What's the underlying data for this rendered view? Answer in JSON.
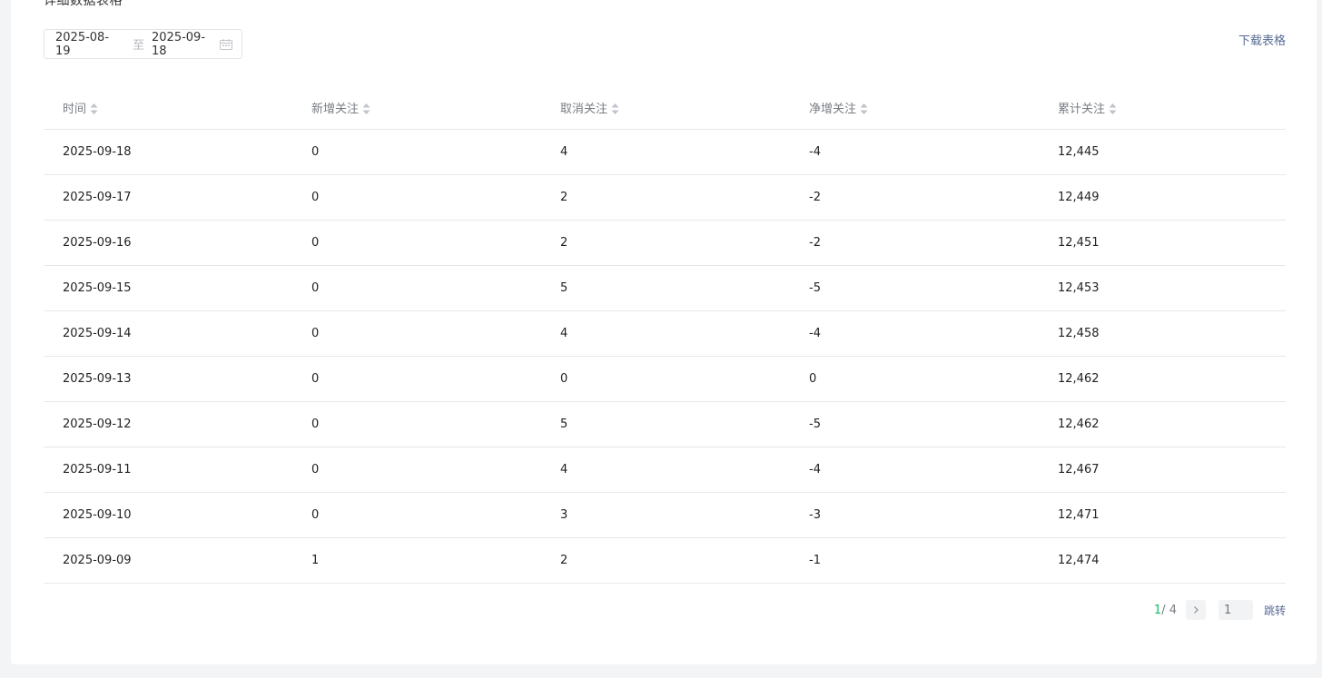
{
  "section": {
    "title": "详细数据表格"
  },
  "date_range": {
    "start": "2025-08-19",
    "separator": "至",
    "end": "2025-09-18",
    "icon": "calendar-icon"
  },
  "toolbar": {
    "download_label": "下载表格"
  },
  "table": {
    "columns": [
      "时间",
      "新增关注",
      "取消关注",
      "净增关注",
      "累计关注"
    ],
    "rows": [
      [
        "2025-09-18",
        "0",
        "4",
        "-4",
        "12,445"
      ],
      [
        "2025-09-17",
        "0",
        "2",
        "-2",
        "12,449"
      ],
      [
        "2025-09-16",
        "0",
        "2",
        "-2",
        "12,451"
      ],
      [
        "2025-09-15",
        "0",
        "5",
        "-5",
        "12,453"
      ],
      [
        "2025-09-14",
        "0",
        "4",
        "-4",
        "12,458"
      ],
      [
        "2025-09-13",
        "0",
        "0",
        "0",
        "12,462"
      ],
      [
        "2025-09-12",
        "0",
        "5",
        "-5",
        "12,462"
      ],
      [
        "2025-09-11",
        "0",
        "4",
        "-4",
        "12,467"
      ],
      [
        "2025-09-10",
        "0",
        "3",
        "-3",
        "12,471"
      ],
      [
        "2025-09-09",
        "1",
        "2",
        "-1",
        "12,474"
      ]
    ]
  },
  "pagination": {
    "current": "1",
    "total": " / 4",
    "input_placeholder": "1",
    "jump_label": "跳转"
  },
  "colors": {
    "accent_green": "#07c160",
    "link_blue": "#576b95",
    "header_gray": "#7a7d84",
    "divider": "#e6e8eb"
  }
}
